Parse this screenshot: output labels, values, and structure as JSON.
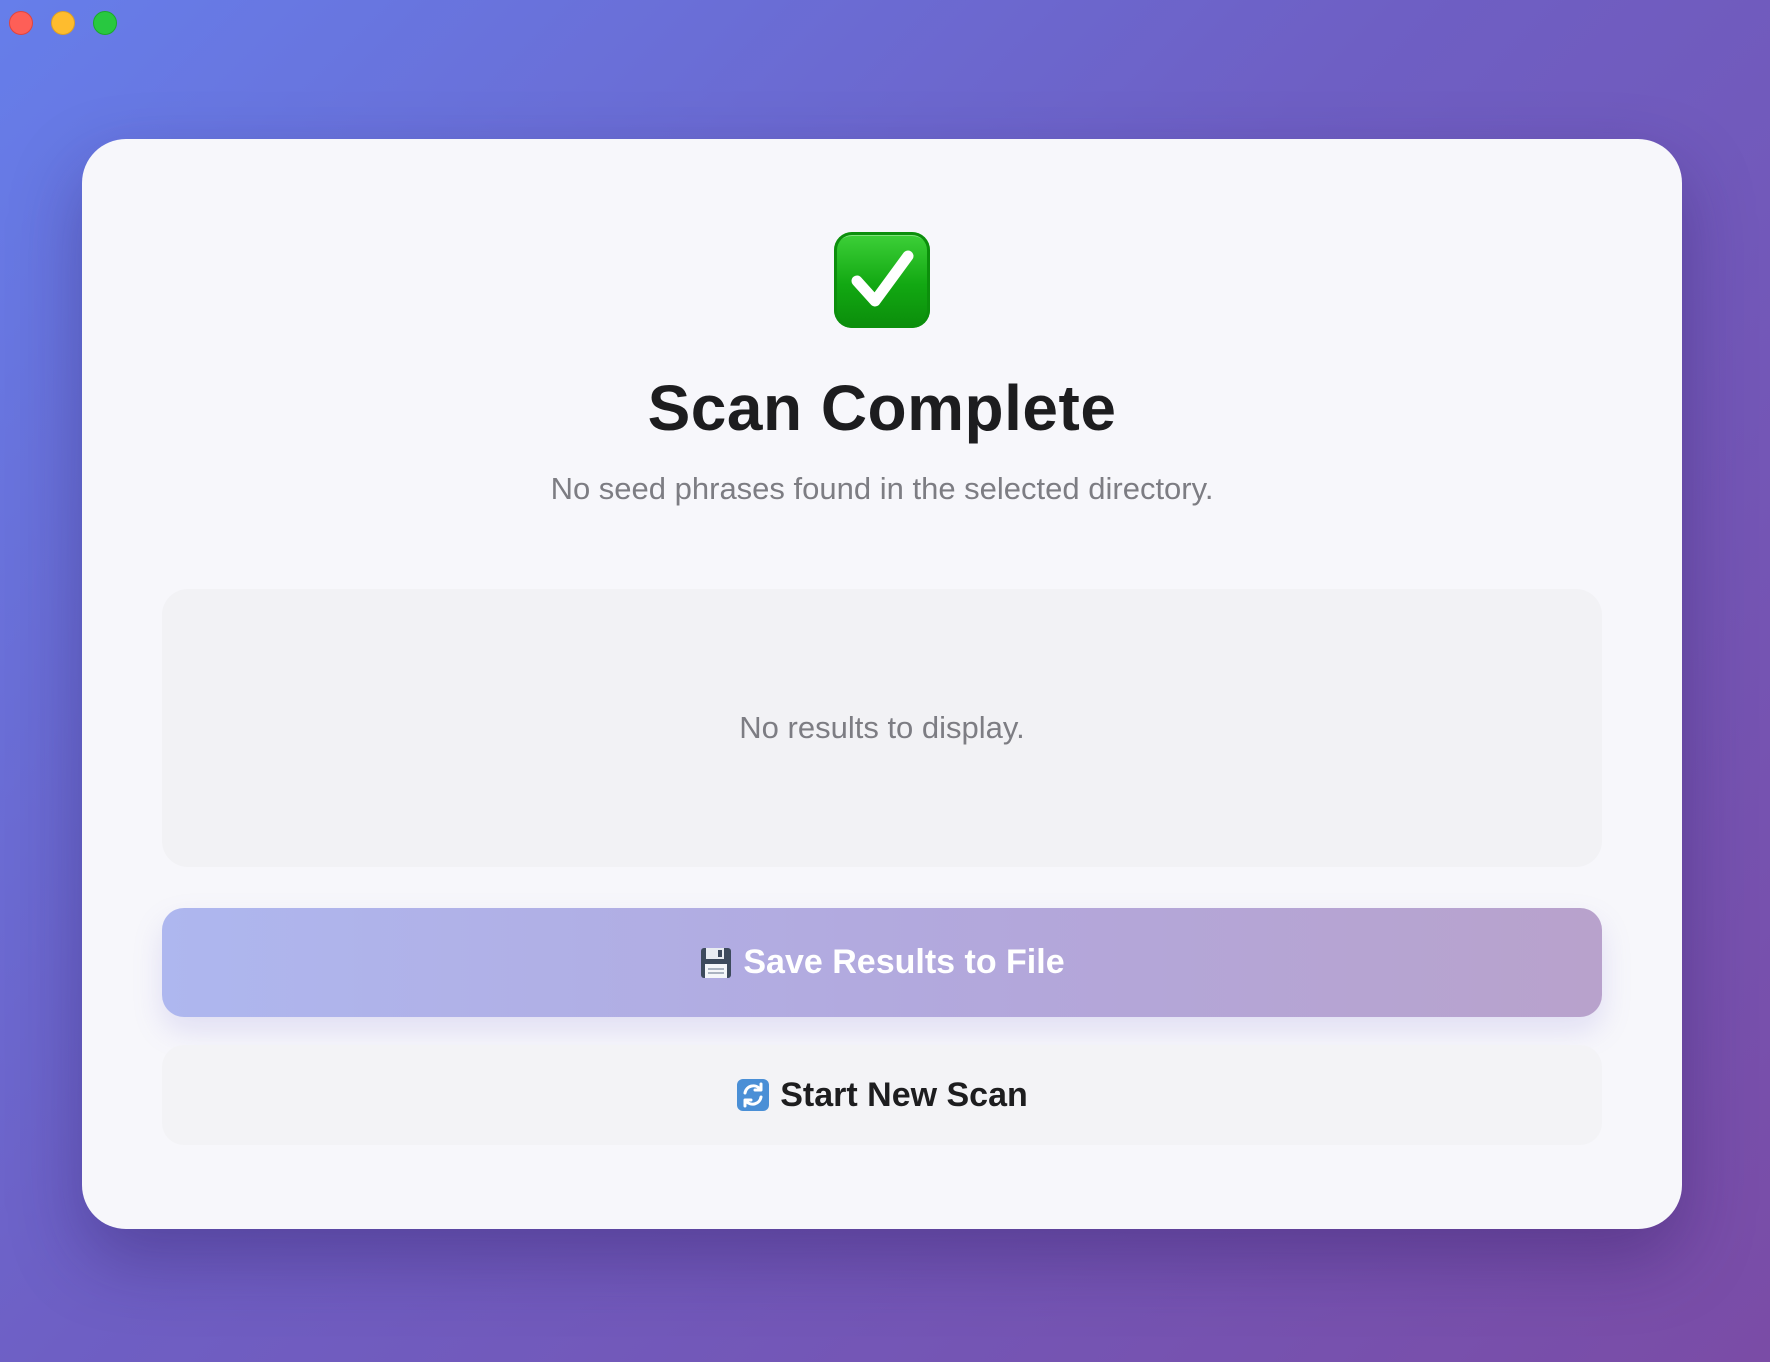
{
  "window": {
    "controls": [
      "close",
      "minimize",
      "maximize"
    ]
  },
  "status": {
    "icon": "check-mark-button-icon",
    "title": "Scan Complete",
    "subtitle": "No seed phrases found in the selected directory."
  },
  "results": {
    "empty_text": "No results to display."
  },
  "actions": {
    "save_icon": "floppy-disk-icon",
    "save_label": "Save Results to File",
    "new_scan_icon": "refresh-icon",
    "new_scan_label": "Start New Scan"
  },
  "colors": {
    "accent_start": "#667eea",
    "accent_end": "#764ba2",
    "success": "#12a812"
  }
}
